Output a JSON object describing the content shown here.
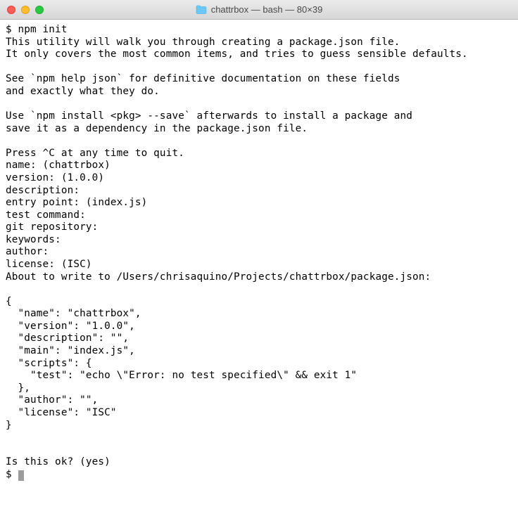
{
  "window": {
    "title": "chattrbox — bash — 80×39"
  },
  "terminal": {
    "lines": [
      "$ npm init",
      "This utility will walk you through creating a package.json file.",
      "It only covers the most common items, and tries to guess sensible defaults.",
      "",
      "See `npm help json` for definitive documentation on these fields",
      "and exactly what they do.",
      "",
      "Use `npm install <pkg> --save` afterwards to install a package and",
      "save it as a dependency in the package.json file.",
      "",
      "Press ^C at any time to quit.",
      "name: (chattrbox)",
      "version: (1.0.0)",
      "description:",
      "entry point: (index.js)",
      "test command:",
      "git repository:",
      "keywords:",
      "author:",
      "license: (ISC)",
      "About to write to /Users/chrisaquino/Projects/chattrbox/package.json:",
      "",
      "{",
      "  \"name\": \"chattrbox\",",
      "  \"version\": \"1.0.0\",",
      "  \"description\": \"\",",
      "  \"main\": \"index.js\",",
      "  \"scripts\": {",
      "    \"test\": \"echo \\\"Error: no test specified\\\" && exit 1\"",
      "  },",
      "  \"author\": \"\",",
      "  \"license\": \"ISC\"",
      "}",
      "",
      "",
      "Is this ok? (yes)"
    ],
    "prompt": "$ "
  }
}
